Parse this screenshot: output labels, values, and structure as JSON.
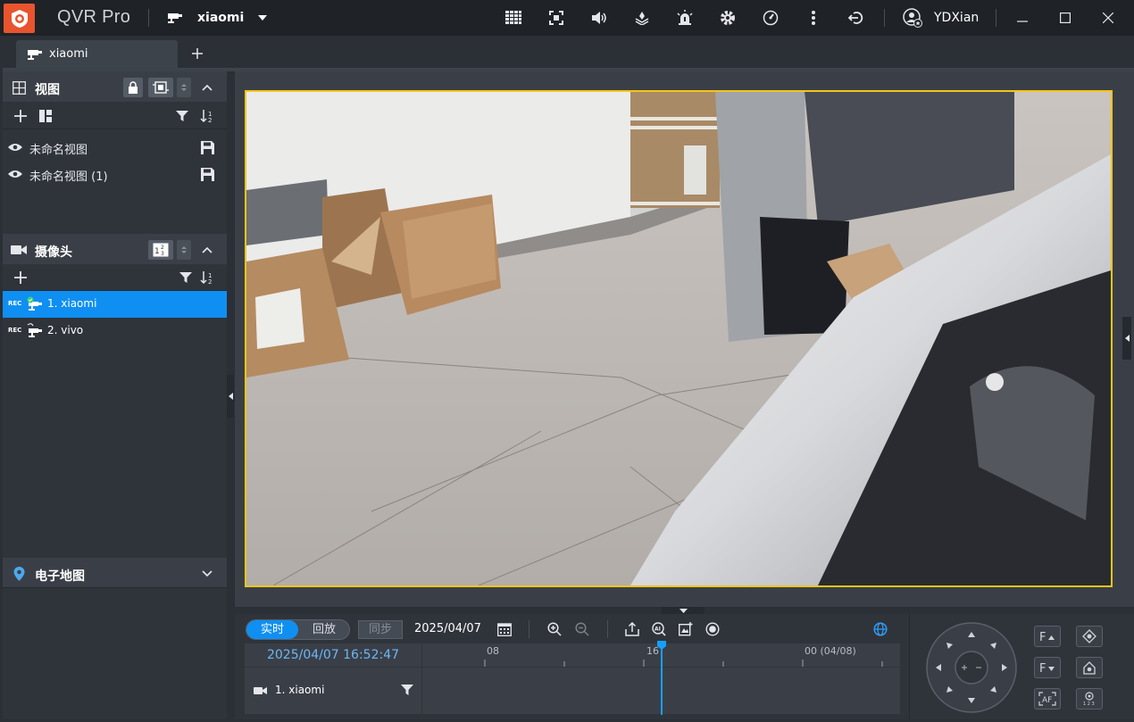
{
  "app": {
    "title": "QVR Pro",
    "server": "xiaomi",
    "user": "YDXian"
  },
  "tabs": [
    {
      "label": "xiaomi"
    }
  ],
  "sidebar": {
    "views": {
      "title": "视图",
      "items": [
        {
          "label": "未命名视图"
        },
        {
          "label": "未命名视图 (1)"
        }
      ]
    },
    "cameras": {
      "title": "摄像头",
      "items": [
        {
          "label": "1. xiaomi",
          "badge": "REC"
        },
        {
          "label": "2. vivo",
          "badge": "REC"
        }
      ]
    },
    "emap": {
      "title": "电子地图"
    }
  },
  "playback": {
    "live_label": "实时",
    "playback_label": "回放",
    "sync_label": "同步",
    "date": "2025/04/07",
    "current_time": "2025/04/07 16:52:47",
    "ticks": [
      "08",
      "16",
      "00 (04/08)"
    ],
    "timeline_camera": "1. xiaomi"
  },
  "colors": {
    "accent": "#0f8ff2",
    "selection_border": "#f5c518",
    "logo": "#e8542d"
  }
}
